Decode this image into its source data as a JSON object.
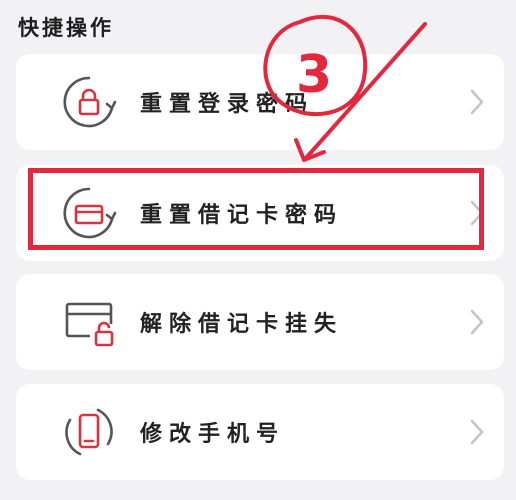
{
  "section": {
    "title": "快捷操作"
  },
  "actions": [
    {
      "label": "重置登录密码",
      "icon": "lock-refresh-icon"
    },
    {
      "label": "重置借记卡密码",
      "icon": "card-refresh-icon"
    },
    {
      "label": "解除借记卡挂失",
      "icon": "card-unlock-icon"
    },
    {
      "label": "修改手机号",
      "icon": "phone-refresh-icon"
    }
  ],
  "annotation": {
    "step_number": "3",
    "color": "#e3283e"
  },
  "colors": {
    "background": "#f2f2f4",
    "card": "#ffffff",
    "icon_gray": "#555555",
    "icon_red": "#d9333f",
    "chevron": "#c4c4c4"
  }
}
